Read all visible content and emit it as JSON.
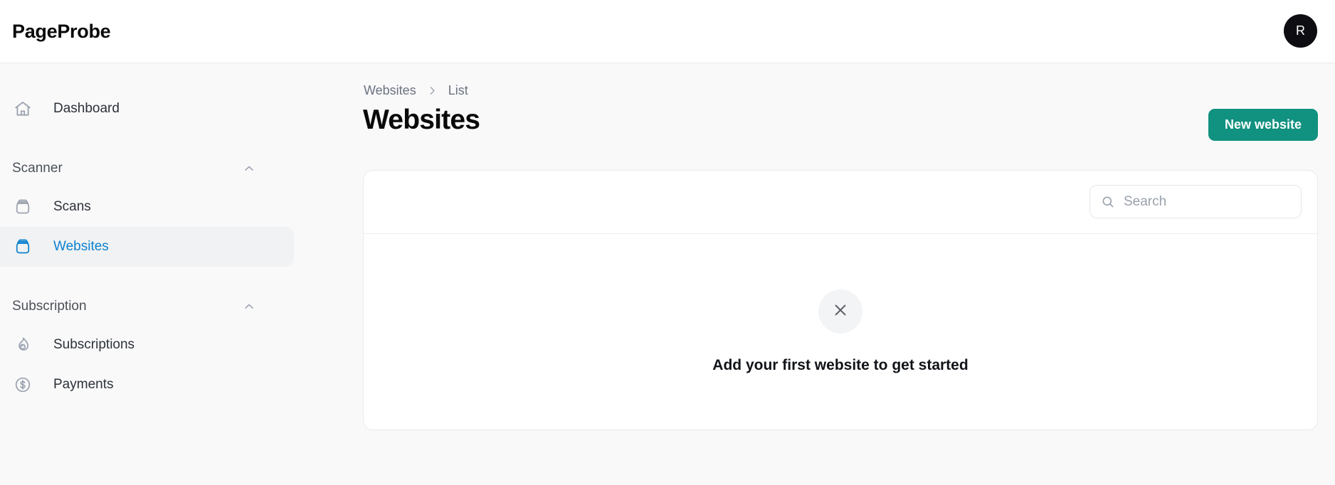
{
  "header": {
    "brand": "PageProbe",
    "avatar_initial": "R"
  },
  "sidebar": {
    "top_items": [
      {
        "label": "Dashboard",
        "icon": "home-icon",
        "active": false
      }
    ],
    "sections": [
      {
        "title": "Scanner",
        "chevron": "chevron-up-icon",
        "items": [
          {
            "label": "Scans",
            "icon": "archive-box-icon",
            "active": false
          },
          {
            "label": "Websites",
            "icon": "archive-box-icon",
            "active": true
          }
        ]
      },
      {
        "title": "Subscription",
        "chevron": "chevron-up-icon",
        "items": [
          {
            "label": "Subscriptions",
            "icon": "flame-icon",
            "active": false
          },
          {
            "label": "Payments",
            "icon": "dollar-circle-icon",
            "active": false
          }
        ]
      }
    ]
  },
  "main": {
    "breadcrumb": {
      "first": "Websites",
      "separator_icon": "chevron-right-icon",
      "last": "List"
    },
    "page_title": "Websites",
    "new_button": "New website",
    "search": {
      "icon": "search-icon",
      "placeholder": "Search",
      "value": ""
    },
    "empty_state": {
      "icon": "close-x-icon",
      "message": "Add your first website to get started"
    }
  },
  "colors": {
    "accent_teal": "#11917f",
    "active_blue": "#0c82d0",
    "page_background": "#f9f9fa",
    "card_background": "#ffffff"
  }
}
